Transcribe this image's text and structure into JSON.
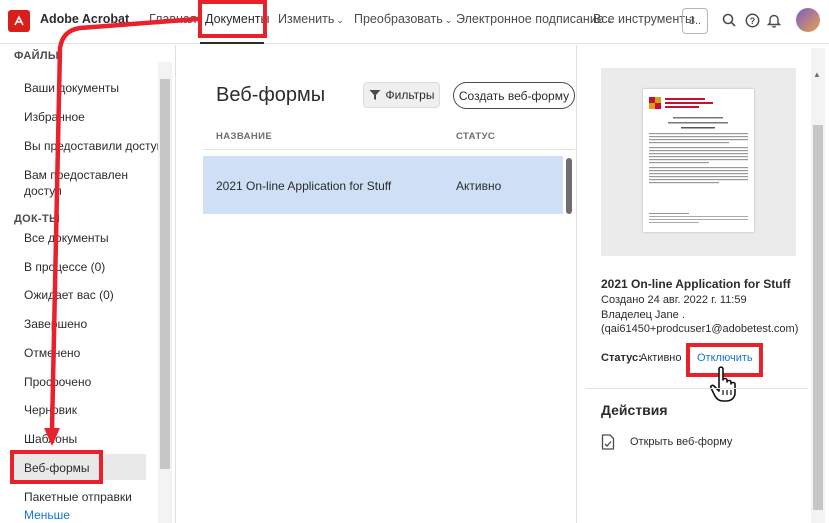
{
  "app": {
    "brand": "Adobe Acrobat",
    "brand_color": "#d91e18"
  },
  "topnav": {
    "home": "Главная",
    "documents": "Документы",
    "edit": "Изменить",
    "convert": "Преобразовать",
    "esign": "Электронное подписание",
    "all_tools": "Все инструменты",
    "button_3": "3..",
    "icons": [
      "search-icon",
      "help-icon",
      "bell-icon"
    ]
  },
  "sidebar": {
    "files_header": "ФАЙЛЫ",
    "files_items": [
      "Ваши документы",
      "Избранное",
      "Вы предоставили доступ",
      "Вам предоставлен",
      "доступ"
    ],
    "docs_header": "ДОК-ТЫ",
    "docs_items": [
      "Все документы",
      "В процессе (0)",
      "Ожидает вас (0)",
      "Завершено",
      "Отменено",
      "Просрочено",
      "Черновик",
      "Шаблоны",
      "Веб-формы",
      "Пакетные отправки"
    ],
    "less": "Меньше"
  },
  "main": {
    "title": "Веб-формы",
    "filters": "Фильтры",
    "create": "Создать веб-форму",
    "col_name": "НАЗВАНИЕ",
    "col_status": "СТАТУС",
    "rows": [
      {
        "name": "2021 On-line Application for Stuff",
        "status": "Активно"
      }
    ]
  },
  "details": {
    "title": "2021 On-line Application for Stuff",
    "created": "Создано 24 авг. 2022 г. 11:59",
    "owner": "Владелец Jane .",
    "email": "(qai61450+prodcuser1@adobetest.com)",
    "status_label": "Статус:",
    "status_value": "Активно",
    "disable": "Отключить",
    "actions_header": "Действия",
    "open_webform": "Открыть веб-форму"
  },
  "colors": {
    "accent_link": "#1473e6",
    "highlight_red": "#e8212b",
    "selected_row": "#cfe0f6"
  }
}
